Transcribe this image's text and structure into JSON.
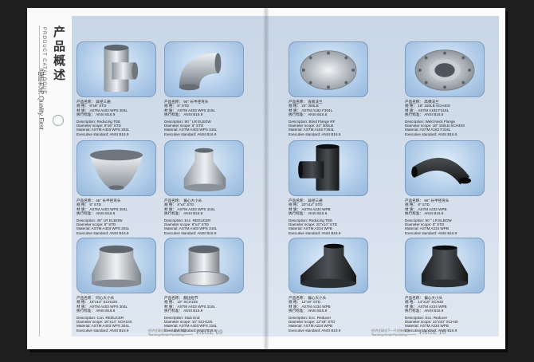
{
  "catalogue": {
    "title_cn": "产品概述",
    "title_en": "PRODUCT CATALOGUE",
    "slogan": "品质为先 Quality First"
  },
  "footer": {
    "left_note": "经济全球化下一片创新制造",
    "left_brand": "Tianxing Metal Pipefitting",
    "left_page": "PAGE 09",
    "right_note": "经济全球化下一片创新制造",
    "right_brand": "Tianxing Metal Pipefitting",
    "right_page": "PAGE 10"
  },
  "products": [
    {
      "icon": "tee-icon",
      "name": "产品名称：  异径三通",
      "spec": "规    格：   8\"x6\" STD",
      "material": "材    质：   ASTM A403 WPS 304L",
      "standard": "执行标准：  ANSI B16.9",
      "desc": "Description: Reducing TEE",
      "diameter": "Diameter scope: 8\"x6\" STD",
      "mat_en": "Material: ASTM A403 WPS 304L",
      "std_en": "Executive standard: ANSI B16.9"
    },
    {
      "icon": "elbow-icon",
      "name": "产品名称：  90° 长半径弯头",
      "spec": "规    格：   6\" STD",
      "material": "材    质：   ASTM A403 WPS 316L",
      "standard": "执行标准：  ANSI B16.9",
      "desc": "Description: 90 ° LR ELBOW",
      "diameter": "Diameter scope: 6\" STD",
      "mat_en": "Material: ASTM A403 WPS 316L",
      "std_en": "Executive standard: ANSI B16.9"
    },
    {
      "icon": "blind-flange-icon",
      "name": "产品名称：  盲板法兰",
      "spec": "规    格：   24\" 300LB",
      "material": "材    质：   ASTM A182 F304L",
      "standard": "执行标准：  ANSI B16.5",
      "desc": "Description: Blind Flange RF",
      "diameter": "Diameter scope: 24\" 300LB",
      "mat_en": "Material: ASTM A182 F304L",
      "std_en": "Executive standard: ANSI B16.5"
    },
    {
      "icon": "weld-neck-flange-icon",
      "name": "产品名称：  高颈法兰",
      "spec": "规    格：   18\" 150LB SCH40S",
      "material": "材    质：   ASTM A182 F316L",
      "standard": "执行标准：  ANSI B16.5",
      "desc": "Description: Weld Neck Flange",
      "diameter": "Diameter scope: 18\" 150LB SCH40S",
      "mat_en": "Material: ASTM A182 F316L",
      "std_en": "Executive standard: ANSI B16.5"
    },
    {
      "icon": "elbow-45-icon",
      "name": "产品名称：  45° 长半径弯头",
      "spec": "规    格：   8\" STD",
      "material": "材    质：   ASTM A403 WPS 304L",
      "standard": "执行标准：  ANSI B16.9",
      "desc": "Description: 45° LR ELBOW",
      "diameter": "Diameter scope: 8\" STD",
      "mat_en": "Material: ASTM A403 WPS 304L",
      "std_en": "Executive standard: ANSI B16.9"
    },
    {
      "icon": "ecc-reducer-icon",
      "name": "产品名称：  偏心大小头",
      "spec": "规    格：   8\"x4\" STD",
      "material": "材    质：   ASTM A403 WPS 316L",
      "standard": "执行标准：  ANSI B16.9",
      "desc": "Description: Ecc. REDUCER",
      "diameter": "Diameter scope: 8\"x4\" STD",
      "mat_en": "Material: ASTM A403 WPS 316L",
      "std_en": "Executive standard: ANSI B16.9"
    },
    {
      "icon": "black-tee-icon",
      "name": "产品名称：  异径三通",
      "spec": "规    格：   20\"x14\" STD",
      "material": "材    质：   ASTM A234 WPB",
      "standard": "执行标准：  ANSI B16.9",
      "desc": "Description: Reducing TEE",
      "diameter": "Diameter scope: 20\"x14\" STD",
      "mat_en": "Material: ASTM A234 WPB",
      "std_en": "Executive standard: ANSI B16.9"
    },
    {
      "icon": "black-elbow-icon",
      "name": "产品名称：  90° 长半径弯头",
      "spec": "规    格：   8\" STD",
      "material": "材    质：   ASTM A234 WPB",
      "standard": "执行标准：  ANSI B16.9",
      "desc": "Description: 90 ° LR ELBOW",
      "diameter": "Diameter scope: 8\" STD",
      "mat_en": "Material: ASTM A234 WPB",
      "std_en": "Executive standard: ANSI B16.9"
    },
    {
      "icon": "con-reducer-icon",
      "name": "产品名称：  同心大小头",
      "spec": "规    格：   16\"x14\" SCH10S",
      "material": "材    质：   ASTM A403 WPS 304L",
      "standard": "执行标准：  ANSI B16.9",
      "desc": "Description: Con. REDUCER",
      "diameter": "Diameter scope: 16\"x14\" SCH10S",
      "mat_en": "Material: ASTM A403 WPS 304L",
      "std_en": "Executive standard: ANSI B16.9"
    },
    {
      "icon": "stub-end-icon",
      "name": "产品名称：  翻边短节",
      "spec": "规    格：   10\" SCH10S",
      "material": "材    质：   ASTM A403 WPS 316L",
      "standard": "执行标准：  ANSI B16.9",
      "desc": "Description: Stub End",
      "diameter": "Diameter scope: 10\" SCH10S",
      "mat_en": "Material: ASTM A403 WPS 316L",
      "std_en": "Executive standard: ANSI B16.9"
    },
    {
      "icon": "black-ecc-reducer-icon",
      "name": "产品名称：  偏心大小头",
      "spec": "规    格：   12\"x8\" STD",
      "material": "材    质：   ASTM A234 WPB",
      "standard": "执行标准：  ANSI B16.9",
      "desc": "Description: Ecc. Reducer",
      "diameter": "Diameter scope: 12\"x8\" STD",
      "mat_en": "Material: ASTM A234 WPB",
      "std_en": "Executive standard: ANSI B16.9"
    },
    {
      "icon": "black-con-reducer-icon",
      "name": "产品名称：  偏心大小头",
      "spec": "规    格：   14\"x10\" SCH40",
      "material": "材    质：   ASTM A234 WPB",
      "standard": "执行标准：  ANSI B16.9",
      "desc": "Description: Ecc. Reducer",
      "diameter": "Diameter scope: 14\"x10\" SCH40",
      "mat_en": "Material: ASTM A234 WPB",
      "std_en": "Executive standard: ANSI B16.9"
    }
  ]
}
